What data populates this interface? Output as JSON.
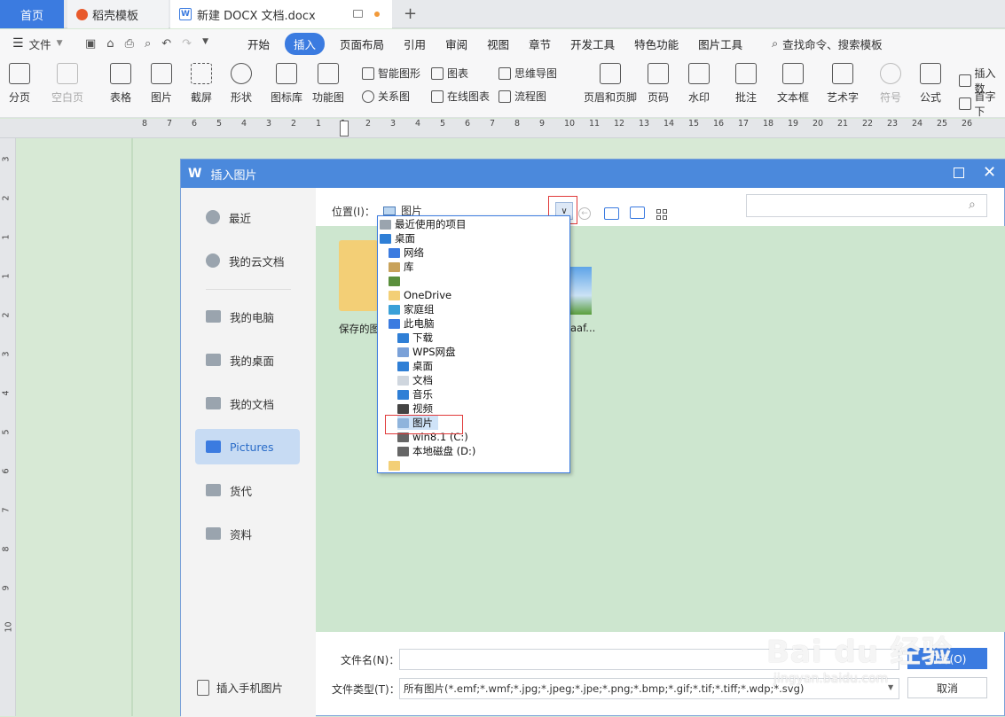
{
  "tabs": {
    "home": "首页",
    "template": "稻壳模板",
    "document": "新建 DOCX 文档.docx"
  },
  "menu": {
    "file": "文件",
    "items": [
      "开始",
      "插入",
      "页面布局",
      "引用",
      "审阅",
      "视图",
      "章节",
      "开发工具",
      "特色功能",
      "图片工具"
    ],
    "active": "插入",
    "search": "查找命令、搜索模板"
  },
  "toolbar": {
    "page_break": "分页",
    "blank_page": "空白页",
    "table": "表格",
    "picture": "图片",
    "screenshot": "截屏",
    "shape": "形状",
    "icon_lib": "图标库",
    "function_chart": "功能图",
    "smart_shape": "智能图形",
    "chart": "图表",
    "mind_map": "思维导图",
    "relation_chart": "关系图",
    "online_chart": "在线图表",
    "flow_chart": "流程图",
    "header_footer": "页眉和页脚",
    "page_number": "页码",
    "watermark": "水印",
    "comment": "批注",
    "text_box": "文本框",
    "art_text": "艺术字",
    "symbol": "符号",
    "formula": "公式",
    "insert_number": "插入数",
    "drop_cap": "首字下"
  },
  "ruler": {
    "top": [
      "8",
      "7",
      "6",
      "5",
      "4",
      "3",
      "2",
      "1",
      "1",
      "2",
      "3",
      "4",
      "5",
      "6",
      "7",
      "8",
      "9",
      "10",
      "11",
      "12",
      "13",
      "14",
      "15",
      "16",
      "17",
      "18",
      "19",
      "20",
      "21",
      "22",
      "23",
      "24",
      "25",
      "26"
    ],
    "left": [
      "3",
      "2",
      "1",
      "1",
      "2",
      "3",
      "4",
      "5",
      "6",
      "7",
      "8",
      "9",
      "10"
    ]
  },
  "dialog": {
    "title": "插入图片",
    "location_label": "位置(I)：",
    "location_value": "图片",
    "search_placeholder": "",
    "sidebar": [
      {
        "label": "最近",
        "icon": "clock-icon"
      },
      {
        "label": "我的云文档",
        "icon": "cloud-icon"
      },
      {
        "label": "我的电脑",
        "icon": "computer-icon"
      },
      {
        "label": "我的桌面",
        "icon": "desktop-icon"
      },
      {
        "label": "我的文档",
        "icon": "folder-icon"
      },
      {
        "label": "Pictures",
        "icon": "folder-icon"
      },
      {
        "label": "货代",
        "icon": "folder-icon"
      },
      {
        "label": "资料",
        "icon": "folder-icon"
      }
    ],
    "active_sidebar": "Pictures",
    "insert_mobile": "插入手机图片",
    "files": [
      {
        "name": "保存的图",
        "type": "folder"
      },
      {
        "name": "aaf...",
        "type": "image"
      }
    ],
    "filename_label": "文件名(N)：",
    "filename_value": "",
    "filetype_label": "文件类型(T)：",
    "filetype_value": "所有图片(*.emf;*.wmf;*.jpg;*.jpeg;*.jpe;*.png;*.bmp;*.gif;*.tif;*.tiff;*.wdp;*.svg)",
    "open_button": "打开(O)",
    "cancel_button": "取消"
  },
  "dropdown": {
    "items": [
      {
        "label": "最近使用的项目",
        "icon": "recent-icon",
        "indent": 0
      },
      {
        "label": "桌面",
        "icon": "desktop-icon",
        "indent": 0
      },
      {
        "label": "网络",
        "icon": "network-icon",
        "indent": 1
      },
      {
        "label": "库",
        "icon": "library-icon",
        "indent": 1
      },
      {
        "label": "",
        "icon": "user-icon",
        "indent": 1
      },
      {
        "label": "OneDrive",
        "icon": "folder-icon",
        "indent": 1
      },
      {
        "label": "家庭组",
        "icon": "homegroup-icon",
        "indent": 1
      },
      {
        "label": "此电脑",
        "icon": "pc-icon",
        "indent": 1
      },
      {
        "label": "下载",
        "icon": "download-icon",
        "indent": 2
      },
      {
        "label": "WPS网盘",
        "icon": "cloud-icon",
        "indent": 2
      },
      {
        "label": "桌面",
        "icon": "desktop-icon",
        "indent": 2
      },
      {
        "label": "文档",
        "icon": "document-icon",
        "indent": 2
      },
      {
        "label": "音乐",
        "icon": "music-icon",
        "indent": 2
      },
      {
        "label": "视频",
        "icon": "video-icon",
        "indent": 2
      },
      {
        "label": "图片",
        "icon": "picture-icon",
        "indent": 2
      },
      {
        "label": "win8.1 (C:)",
        "icon": "drive-icon",
        "indent": 2
      },
      {
        "label": "本地磁盘 (D:)",
        "icon": "drive-icon",
        "indent": 2
      },
      {
        "label": "",
        "icon": "folder-icon",
        "indent": 1
      }
    ],
    "selected": "图片"
  },
  "watermark": {
    "text": "Bai du 经验",
    "url": "jingyan.baidu.com"
  },
  "colors": {
    "accent": "#3b7be0",
    "dialog_title": "#4b89dc",
    "highlight_box": "#e03a3a"
  }
}
